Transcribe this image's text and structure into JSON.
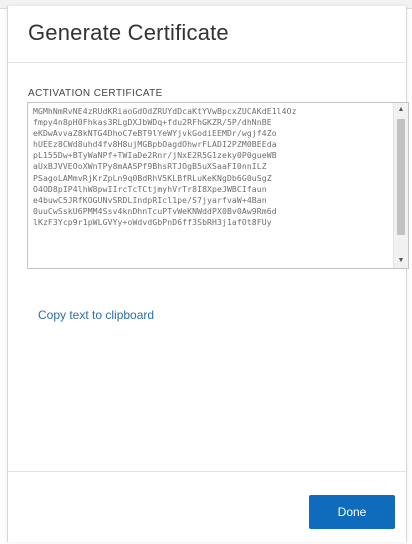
{
  "dialog": {
    "title": "Generate Certificate",
    "field_label": "ACTIVATION CERTIFICATE",
    "certificate_lines": [
      "MGMhNmRvNE4zRUdKRiaoGdOdZRUYdDcaKtYVwBpcxZUCAKdE1l4Oz",
      "fmpy4n8pH0Fhkas3RLgDXJbWDq+fdu2RFhGKZR/5P/dhNnBE",
      "eKDwAvvaZ8kNTG4DhoC7eBT9lYeWYjvkGodiEEMDr/wgjf4Zo",
      "hUEEz8CWd8uhd4fv8H8ujMGBpbOagdOhwrFLADI2PZM0BEEda",
      "pL155Dw+BTyWaNPf+TWIaDe2Rnr/jNxE2R5G1zeky0P0gueWB",
      "aUxBJVVEOoXWnTPy8mAASPf9BhsRTJOgB5uXSaaFI0nnILZ",
      "PSagoLAMmvRjKrZpLn9q0BdRhV5KLBfRLuKeKNgDb6G0uSgZ",
      "O4OD8pIP4lhW8pwIIrcTcTCtjmyhVrTr8I8XpeJWBCIfaun",
      "e4buwC5JRfKOGUNvSRDLIndpRIcl1pe/S7jyarfvaW+4Ban",
      "0uuCwSskU6PMM4Ssv4knDhnTcuPTvWeKNWddPX0Bv0Aw9Rm6d",
      "lKzF3Ycp9r1pWLGVYy+oWdvdGbPnD6ff3SbRH3j1afOt8FUy"
    ],
    "copy_link": "Copy text to clipboard",
    "done_label": "Done"
  },
  "colors": {
    "accent": "#0f6cbd",
    "link": "#2d6fa8"
  }
}
